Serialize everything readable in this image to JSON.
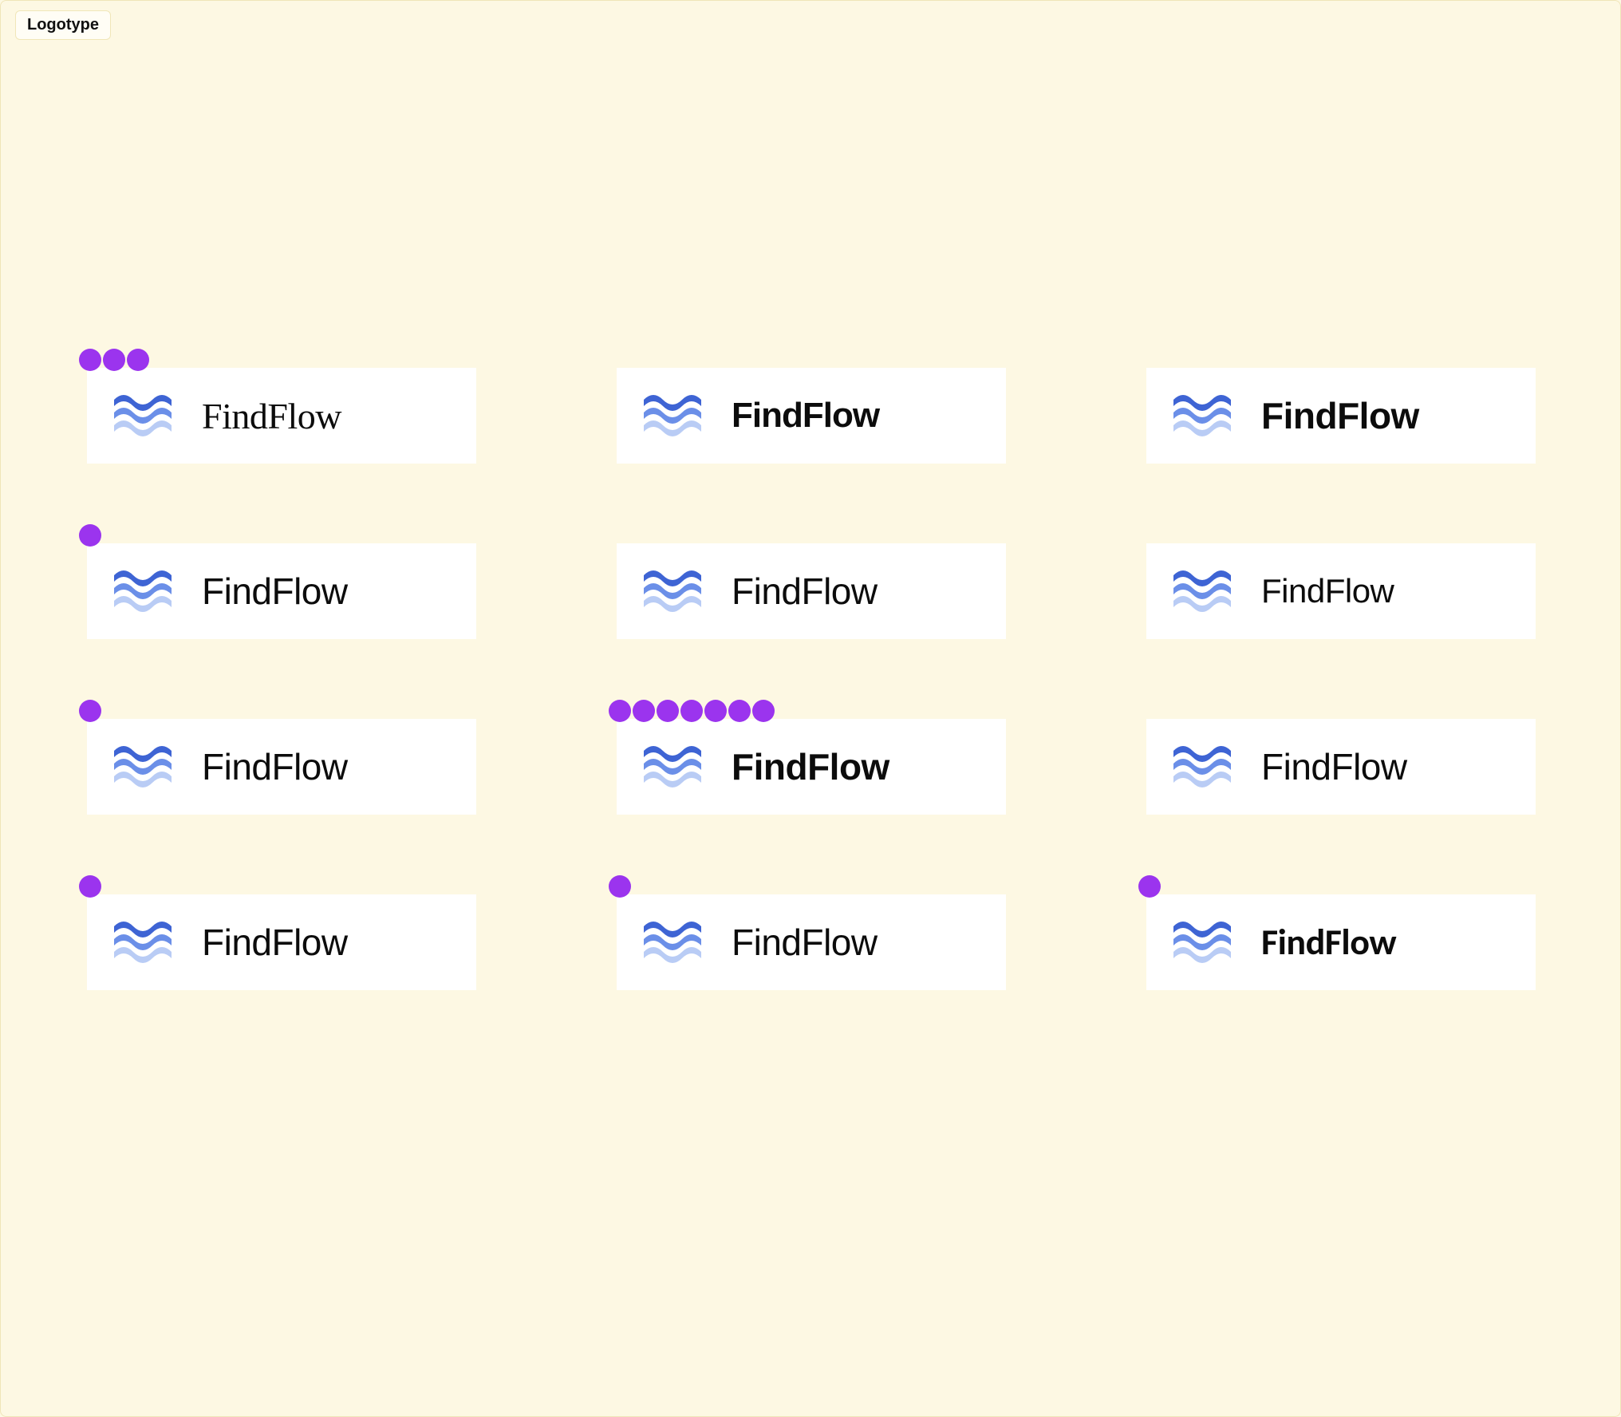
{
  "section_label": "Logotype",
  "brand_name": "FindFlow",
  "mark_colors": {
    "wave1": "#3E64D4",
    "wave2": "#6B8FE8",
    "wave3": "#B9CCF5"
  },
  "dot_color": "#9B34EE",
  "variants": [
    {
      "id": 0,
      "dots": 3,
      "style": "ws-0"
    },
    {
      "id": 1,
      "dots": 0,
      "style": "ws-1"
    },
    {
      "id": 2,
      "dots": 0,
      "style": "ws-2"
    },
    {
      "id": 3,
      "dots": 1,
      "style": "ws-3"
    },
    {
      "id": 4,
      "dots": 0,
      "style": "ws-4"
    },
    {
      "id": 5,
      "dots": 0,
      "style": "ws-5"
    },
    {
      "id": 6,
      "dots": 1,
      "style": "ws-6"
    },
    {
      "id": 7,
      "dots": 7,
      "style": "ws-7"
    },
    {
      "id": 8,
      "dots": 0,
      "style": "ws-8"
    },
    {
      "id": 9,
      "dots": 1,
      "style": "ws-9"
    },
    {
      "id": 10,
      "dots": 1,
      "style": "ws-10"
    },
    {
      "id": 11,
      "dots": 1,
      "style": "ws-11"
    }
  ]
}
